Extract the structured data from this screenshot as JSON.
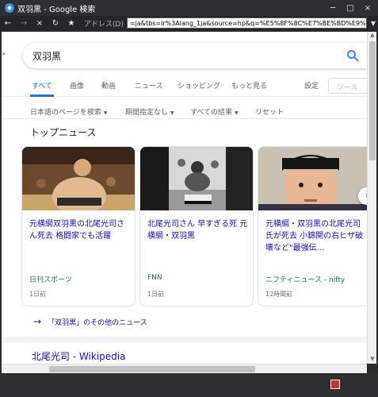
{
  "window": {
    "title": "双羽黒 - Google 検索",
    "controls": {
      "minimize": "─",
      "maximize": "□",
      "close": "×"
    }
  },
  "toolbar": {
    "back": "←",
    "forward": "→",
    "stop": "×",
    "reload": "↻",
    "favorite": "★",
    "address_label": "アドレス(D)",
    "address_value": "=ja&tbs=lr%3Alang_1ja&source=hp&q=%E5%8F%8C%E7%BE%BD%E9%BB%92",
    "address_dropdown": "▼"
  },
  "search": {
    "query": "双羽黒"
  },
  "tabs": [
    {
      "label": "すべて",
      "active": true
    },
    {
      "label": "画像",
      "active": false
    },
    {
      "label": "動画",
      "active": false
    },
    {
      "label": "ニュース",
      "active": false
    },
    {
      "label": "ショッピング",
      "active": false
    },
    {
      "label": "もっと見る",
      "active": false
    }
  ],
  "settings_label": "設定",
  "tools_label": "ツール",
  "filters": {
    "language": "日本語のページを検索",
    "time": "期間指定なし",
    "results": "すべての結果",
    "reset": "リセット"
  },
  "top_news_title": "トップニュース",
  "news_cards": [
    {
      "headline": "元横綱双羽黒の北尾光司さん死去 格闘家でも活躍",
      "source": "日刊スポーツ",
      "age": "1日前"
    },
    {
      "headline": "北尾光司さん 早すぎる死 元横綱・双羽黒",
      "source": "FNN",
      "age": "1日前"
    },
    {
      "headline": "元横綱・双羽黒の北尾光司氏が死去 小錦関の右ヒザ破壊など\"最強伝...",
      "source": "ニフティニュース - nifty",
      "age": "12時間前"
    }
  ],
  "more_news": "「双羽黒」のその他のニュース",
  "wiki_result": "北尾光司 - Wikipedia",
  "colors": {
    "link": "#1a0dab",
    "accent": "#1a73e8",
    "source": "#188038"
  }
}
